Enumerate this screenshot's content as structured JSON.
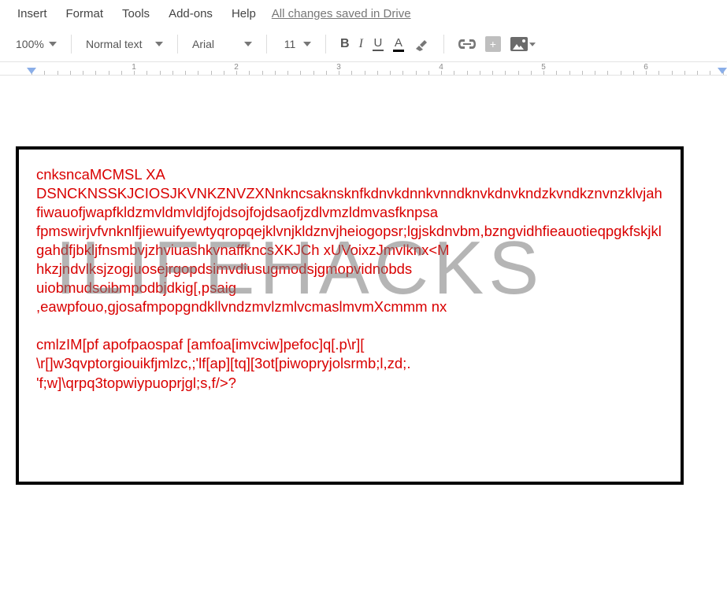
{
  "menubar": {
    "items": [
      "Insert",
      "Format",
      "Tools",
      "Add-ons",
      "Help"
    ],
    "save_status": "All changes saved in Drive"
  },
  "toolbar": {
    "zoom": "100%",
    "paragraph_style": "Normal text",
    "font": "Arial",
    "font_size": "11",
    "bold_label": "B",
    "italic_label": "I",
    "underline_label": "U",
    "textcolor_label": "A"
  },
  "ruler": {
    "labels": [
      "1",
      "2",
      "3",
      "4",
      "5",
      "6"
    ]
  },
  "document": {
    "watermark": "ILIFEHACKS",
    "body": "cnksncaMCMSL XA\nDSNCKNSSKJCIOSJKVNKZNVZXNnkncsaknsknfkdnvkdnnkvnndknvkdnvkndzkvndkznvnzklvjahfiwauofjwapfkldzmvldmvldjfojdsojfojdsaofjzdlvmzldmvasfknpsa\nfpmswirjvfvnknlfjiewuifyewtyqropqejklvnjkldznvjheiogopsr;lgjskdnvbm,bzngvidhfieauotieqpgkfskjklgahdfjbkljfnsmbvjzhviuashkvnaffkncsXKJCh xUVoixzJmvlknx<M\nhkzjndvlksjzogjuosejrgopdsimvdiusugmodsjgmopvidnobds\nuiobmudsoibmpodbjdkig[,psaig\n,eawpfouo,gjosafmpopgndkllvndzmvlzmlvcmaslmvmXcmmm nx\n\ncmlzIM[pf apofpaospaf [amfoa[imvciw]pefoc]q[.p\\r][\n\\r[]w3qvptorgiouikfjmlzc,;'lf[ap][tq][3ot[piwopryjolsrmb;l,zd;.\n'f;w]\\qrpq3topwiypuoprjgl;s,f/>?"
  }
}
